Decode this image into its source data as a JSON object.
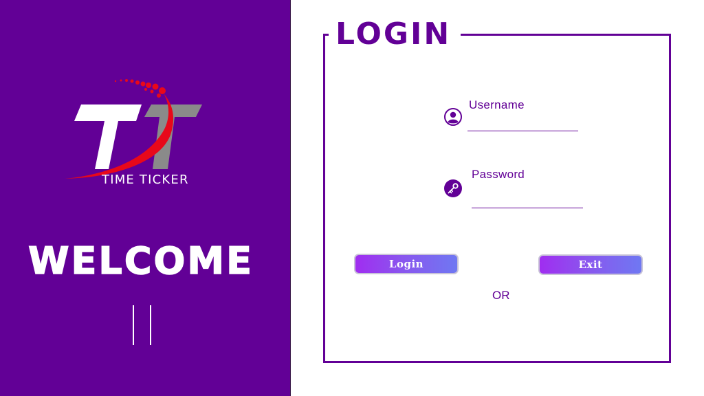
{
  "brand": {
    "logo_icon": "tt-logo-icon",
    "logo_text": "TIME TICKER"
  },
  "welcome": {
    "text": "WELCOME",
    "pause_icon": "pause-icon"
  },
  "login": {
    "title": "LOGIN",
    "username": {
      "label": "Username",
      "icon": "user-icon",
      "value": "",
      "placeholder": ""
    },
    "password": {
      "label": "Password",
      "icon": "key-icon",
      "value": "",
      "placeholder": ""
    },
    "login_button": "Login",
    "exit_button": "Exit",
    "or_text": "OR"
  },
  "colors": {
    "brand_purple": "#620096",
    "logo_red": "#e8081a",
    "logo_gray": "#8a8a8a",
    "button_gradient_start": "#a02df0",
    "button_gradient_end": "#6f78f2"
  }
}
